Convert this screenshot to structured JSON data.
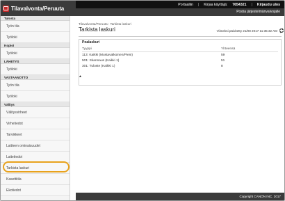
{
  "header": {
    "app_title": "Tilavalvonta/Peruuta",
    "portal_link": "Portaaliin",
    "login_label": "Kirjaa käyttäjä:",
    "user_id": "7654321",
    "logout_link": "Kirjaudu ulos",
    "admin_mail": "Postia järjestelmänvalvojalle"
  },
  "sidebar": {
    "sections": [
      {
        "title": "Tulosta",
        "items": [
          {
            "label": "Työn tila"
          },
          {
            "label": "Työloki"
          }
        ]
      },
      {
        "title": "Kopioi",
        "items": [
          {
            "label": "Työloki"
          }
        ]
      },
      {
        "title": "LÄHETYS",
        "items": [
          {
            "label": "Työloki"
          }
        ]
      },
      {
        "title": "VASTAANOTTO",
        "items": [
          {
            "label": "Työn tila"
          },
          {
            "label": "Työloki"
          }
        ]
      },
      {
        "title": "Välitys",
        "items": [
          {
            "label": "Välitysvirheet"
          },
          {
            "label": "Virhetiedot"
          },
          {
            "label": "Tarvikkeet"
          },
          {
            "label": "Laitteen ominaisuudet"
          },
          {
            "label": "Laitetiedot"
          },
          {
            "label": "Tarkista laskuri"
          },
          {
            "label": "Kasettitila"
          },
          {
            "label": "Ekotiedot"
          }
        ]
      }
    ]
  },
  "main": {
    "breadcrumb": "Tilavalvonta/Peruuta : Tarkista laskuri",
    "title": "Tarkista laskuri",
    "updated": "Viimeksi päivitetty 21/08 2017 11:35:32 AM",
    "panel_title": "Poalaskuri",
    "table": {
      "headers": [
        "Tyyppi",
        "Yhteensä"
      ],
      "rows": [
        [
          "113: Kaikki (Mustavalkoinen/Pieni)",
          "59"
        ],
        [
          "501: Skannaus (Kaikki 1)",
          "51"
        ],
        [
          "301: Tuloste (Kaikki 1)",
          "8"
        ]
      ]
    },
    "back_to_top": "▲"
  },
  "footer": {
    "copyright": "Copyright CANON INC. 2017"
  },
  "colors": {
    "header_dark": "#111111",
    "header_gray": "#3b3b3b",
    "brand_red": "#c62828",
    "highlight": "#e8a21c"
  }
}
